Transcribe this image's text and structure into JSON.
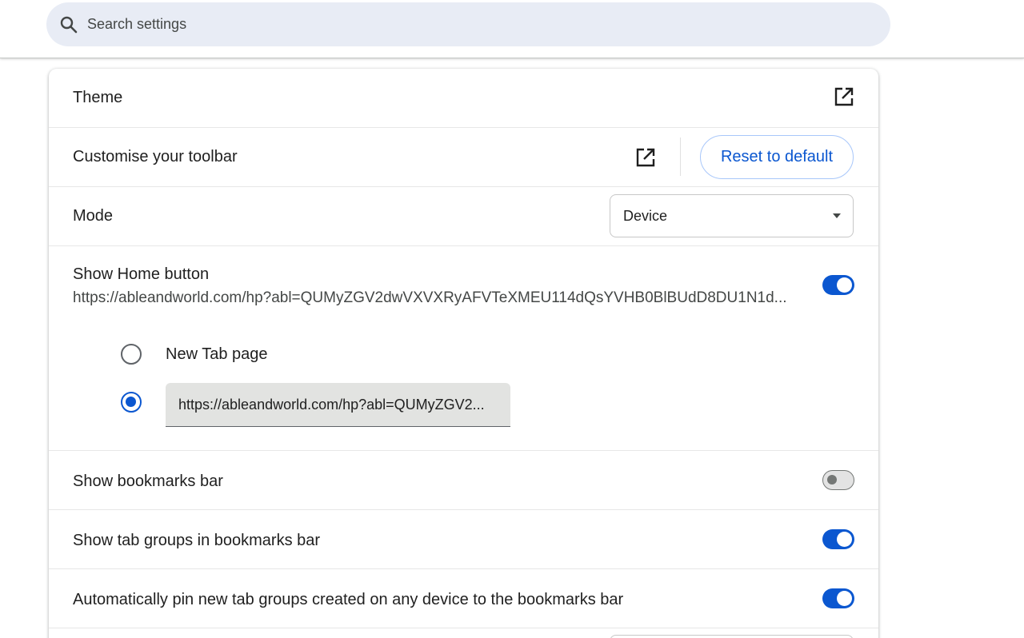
{
  "search": {
    "placeholder": "Search settings",
    "icon": "search-icon"
  },
  "appearance": {
    "theme_label": "Theme",
    "toolbar_label": "Customise your toolbar",
    "reset_label": "Reset to default",
    "mode_label": "Mode",
    "mode_value": "Device",
    "home_label": "Show Home button",
    "home_url": "https://ableandworld.com/hp?abl=QUMyZGV2dwVXVXRyAFVTeXMEU114dQsYVHB0BlBUdD8DU1N1d...",
    "home_enabled": true,
    "radio_newtab_label": "New Tab page",
    "radio_newtab_checked": false,
    "radio_url_checked": true,
    "radio_url_value": "https://ableandworld.com/hp?abl=QUMyZGV2...",
    "bookmarks_label": "Show bookmarks bar",
    "bookmarks_enabled": false,
    "tabgroups_label": "Show tab groups in bookmarks bar",
    "tabgroups_enabled": true,
    "autopin_label": "Automatically pin new tab groups created on any device to the bookmarks bar",
    "autopin_enabled": true
  },
  "colors": {
    "accent": "#0b57d0",
    "search_bg": "#e8ecf5",
    "input_bg": "#e2e3e1"
  }
}
